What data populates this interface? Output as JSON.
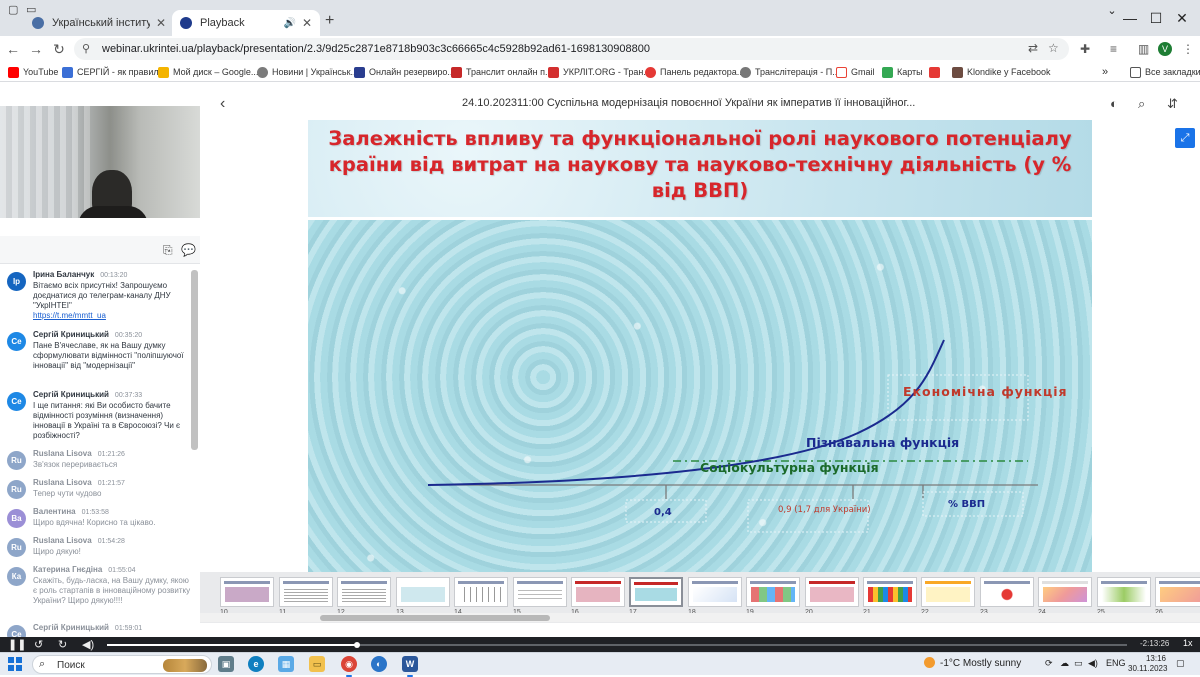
{
  "browser": {
    "tabs": [
      {
        "title": "Український інститут науково",
        "active": false
      },
      {
        "title": "Playback",
        "active": true
      }
    ],
    "url": "webinar.ukrintei.ua/playback/presentation/2.3/9d25c2871e8718b903c3c66665c4c5928b92ad61-1698130908800",
    "profile_initial": "V",
    "bookmarks": [
      {
        "label": "YouTube",
        "color": "#ff0000"
      },
      {
        "label": "СЕРГІЙ - як правил...",
        "color": "#3b6fd6"
      },
      {
        "label": "Мой диск – Google...",
        "color": "#f4b400"
      },
      {
        "label": "Новини | Українськ...",
        "color": "#7b7b7b"
      },
      {
        "label": "Онлайн резервиро...",
        "color": "#2a3d8f"
      },
      {
        "label": "Транслит онлайн п...",
        "color": "#c62828"
      },
      {
        "label": "УКРЛІТ.ORG - Тран...",
        "color": "#d32f2f"
      },
      {
        "label": "Панель редактора...",
        "color": "#e53935"
      },
      {
        "label": "Транслітерація - П...",
        "color": "#777777"
      },
      {
        "label": "Gmail",
        "color": "#e0e0e0"
      },
      {
        "label": "Карты",
        "color": "#34a853"
      },
      {
        "label": "",
        "color": "#e53935"
      },
      {
        "label": "Klondike у Facebook",
        "color": "#6d4c41"
      }
    ],
    "all_bookmarks": "Все закладки"
  },
  "player": {
    "title": "24.10.202311:00 Суспільна модернізація повоєнної України як імператив її інноваційног..."
  },
  "chat": {
    "messages": [
      {
        "initials": "Ір",
        "name": "Ірина Баланчук",
        "time": "00:13:20",
        "text": "Вітаємо всіх присутніх! Запрошуємо доєднатися до телеграм-каналу ДНУ \"УкрІНТЕІ\"",
        "link": "https://t.me/mmtt_ua",
        "color": "#1565c0",
        "gray": false
      },
      {
        "initials": "Се",
        "name": "Сергій Криницький",
        "time": "00:35:20",
        "text": "Пане В'ячеславе, як на Вашу думку сформулювати відмінності \"поліпшуючої інновації\" від \"модернізації\"",
        "link": "",
        "color": "#1e88e5",
        "gray": false
      },
      {
        "initials": "Се",
        "name": "Сергій Криницький",
        "time": "00:37:33",
        "text": "І ще питання: які Ви особисто бачите відмінності розуміння (визначення) інновації в Україні та в Євросоюзі? Чи є розбіжності?",
        "link": "",
        "color": "#1e88e5",
        "gray": false
      },
      {
        "initials": "Ru",
        "name": "Ruslana Lisova",
        "time": "01:21:26",
        "text": "Зв'язок переривається",
        "link": "",
        "color": "#8ea6c9",
        "gray": true
      },
      {
        "initials": "Ru",
        "name": "Ruslana Lisova",
        "time": "01:21:57",
        "text": "Тепер чути чудово",
        "link": "",
        "color": "#8ea6c9",
        "gray": true
      },
      {
        "initials": "Ва",
        "name": "Валентина",
        "time": "01:53:58",
        "text": "Щиро вдячна! Корисно та цікаво.",
        "link": "",
        "color": "#9b8fd6",
        "gray": true
      },
      {
        "initials": "Ru",
        "name": "Ruslana Lisova",
        "time": "01:54:28",
        "text": "Щиро дякую!",
        "link": "",
        "color": "#8ea6c9",
        "gray": true
      },
      {
        "initials": "Ка",
        "name": "Катерина Гнєдіна",
        "time": "01:55:04",
        "text": "Скажіть, будь-ласка, на Вашу думку, якою є роль стартапів в інноваційному розвитку України? Щиро дякую!!!!",
        "link": "",
        "color": "#8ea6c9",
        "gray": true
      },
      {
        "initials": "Се",
        "name": "Сергій Криницький",
        "time": "01:59:01",
        "text": "",
        "link": "",
        "color": "#8ea6c9",
        "gray": true
      }
    ]
  },
  "slide": {
    "title": "Залежність впливу та функціональної ролі наукового потенціалу країни від витрат на наукову та науково-технічну діяльність (у % від ВВП)",
    "curve_labels": {
      "economic": "Економічна функція",
      "cognitive": "Пізнавальна функція",
      "sociocultural": "Соціокультурна функція"
    },
    "axis": {
      "tick1": "0,4",
      "tick2": "0,9 (1,7 для України)",
      "unit": "% ВВП"
    },
    "colors": {
      "title": "#d7262b",
      "curve": "#1b2a8f",
      "economic": "#c0392b",
      "cognitive": "#1b2a8f",
      "sociocultural": "#1b6a2a"
    }
  },
  "thumbnails": {
    "numbers": [
      "10",
      "11",
      "12",
      "13",
      "14",
      "15",
      "16",
      "17",
      "18",
      "19",
      "20",
      "21",
      "22",
      "23",
      "24",
      "25",
      "26"
    ],
    "active_number": "17"
  },
  "playback": {
    "progress_fraction": 0.245,
    "time_left": "-2:13:26",
    "speed": "1x"
  },
  "taskbar": {
    "search": "Поиск",
    "weather": "-1°C  Mostly sunny",
    "lang": "ENG",
    "time": "13:16",
    "date": "30.11.2023"
  }
}
